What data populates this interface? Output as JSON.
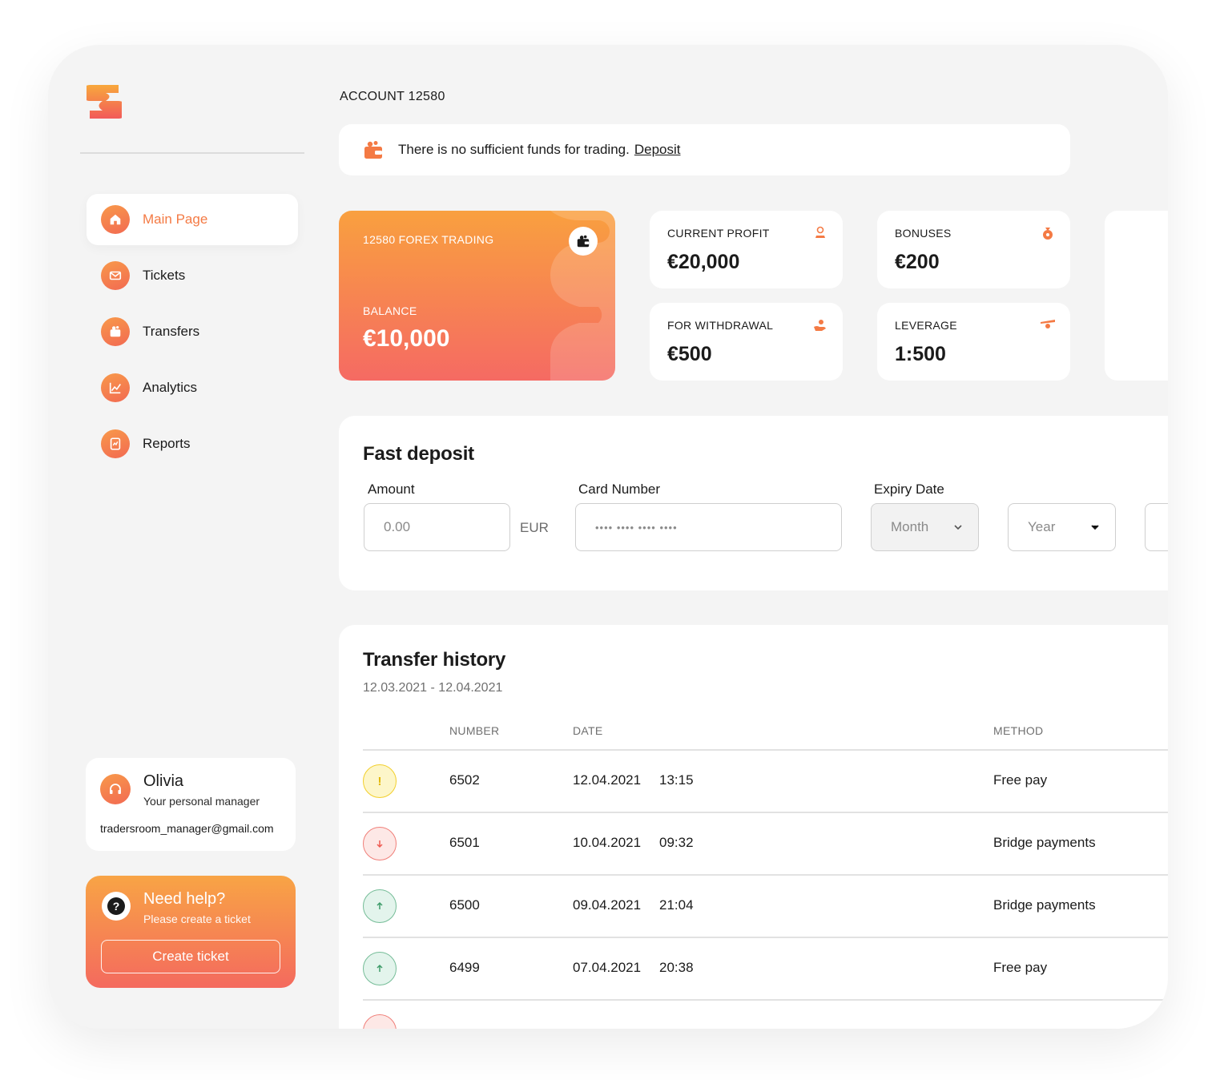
{
  "sidebar": {
    "items": [
      {
        "label": "Main Page",
        "icon": "home-icon",
        "active": true
      },
      {
        "label": "Tickets",
        "icon": "mail-icon"
      },
      {
        "label": "Transfers",
        "icon": "wallet-icon"
      },
      {
        "label": "Analytics",
        "icon": "chart-icon"
      },
      {
        "label": "Reports",
        "icon": "report-icon"
      }
    ],
    "manager": {
      "name": "Olivia",
      "role": "Your personal manager",
      "email": "tradersroom_manager@gmail.com"
    },
    "help": {
      "title": "Need help?",
      "subtitle": "Please create a ticket",
      "button": "Create ticket"
    }
  },
  "header": {
    "account": "ACCOUNT 12580"
  },
  "alert": {
    "text": "There is no sufficient funds for trading.",
    "link": "Deposit"
  },
  "card": {
    "title": "12580 FOREX TRADING",
    "balance_label": "BALANCE",
    "balance_value": "€10,000"
  },
  "stats": [
    {
      "label": "CURRENT PROFIT",
      "value": "€20,000",
      "icon": "profit-icon"
    },
    {
      "label": "BONUSES",
      "value": "€200",
      "icon": "bonus-icon"
    },
    {
      "label": "FOR WITHDRAWAL",
      "value": "€500",
      "icon": "withdrawal-icon"
    },
    {
      "label": "LEVERAGE",
      "value": "1:500",
      "icon": "leverage-icon"
    }
  ],
  "deposit": {
    "title": "Fast deposit",
    "amount_label": "Amount",
    "amount_placeholder": "0.00",
    "currency": "EUR",
    "card_label": "Card Number",
    "card_placeholder": "•••• •••• •••• ••••",
    "expiry_label": "Expiry Date",
    "month": "Month",
    "year": "Year"
  },
  "history": {
    "title": "Transfer history",
    "range": "12.03.2021 - 12.04.2021",
    "columns": {
      "number": "NUMBER",
      "date": "DATE",
      "method": "METHOD"
    },
    "rows": [
      {
        "status": "pending",
        "number": "6502",
        "date": "12.04.2021",
        "time": "13:15",
        "method": "Free pay"
      },
      {
        "status": "out",
        "number": "6501",
        "date": "10.04.2021",
        "time": "09:32",
        "method": "Bridge payments"
      },
      {
        "status": "in",
        "number": "6500",
        "date": "09.04.2021",
        "time": "21:04",
        "method": "Bridge payments"
      },
      {
        "status": "in",
        "number": "6499",
        "date": "07.04.2021",
        "time": "20:38",
        "method": "Free pay"
      }
    ]
  },
  "colors": {
    "accent": "#f47a44",
    "gradient_start": "#f9a03f",
    "gradient_end": "#f56a63",
    "background": "#f4f4f4"
  }
}
